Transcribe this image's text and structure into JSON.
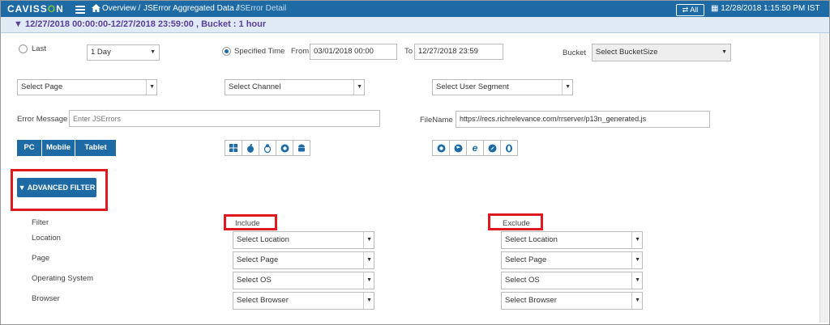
{
  "header": {
    "logo_prefix": "CAVISS",
    "logo_o": "O",
    "logo_suffix": "N",
    "breadcrumb": [
      "Overview /",
      "JSError Aggregated Data /",
      "JSError Detail"
    ],
    "all_label": "All",
    "datetime": "12/28/2018 1:15:50 PM IST"
  },
  "filter_bar": {
    "text": "12/27/2018 00:00:00-12/27/2018 23:59:00 , Bucket : 1 hour"
  },
  "time": {
    "last_label": "Last",
    "last_value": "1 Day",
    "specified_label": "Specified Time",
    "from_label": "From",
    "from_value": "03/01/2018 00:00",
    "to_label": "To",
    "to_value": "12/27/2018 23:59",
    "bucket_label": "Bucket",
    "bucket_value": "Select BucketSize"
  },
  "selects": {
    "page": "Select Page",
    "channel": "Select Channel",
    "user_segment": "Select User Segment"
  },
  "error": {
    "label": "Error Message",
    "placeholder": "Enter JSErrors",
    "filename_label": "FileName",
    "filename_value": "https://recs.richrelevance.com/rrserver/p13n_generated.js"
  },
  "devices": [
    "PC",
    "Mobile",
    "Tablet"
  ],
  "os_icons": [
    "windows-icon",
    "apple-icon",
    "linux-icon",
    "chrome-os-icon",
    "android-icon"
  ],
  "browser_icons": [
    "chrome-icon",
    "firefox-icon",
    "ie-icon",
    "safari-icon",
    "opera-icon"
  ],
  "advanced_filter": {
    "button_label": "ADVANCED FILTER",
    "filter_label": "Filter",
    "include_label": "Include",
    "exclude_label": "Exclude",
    "rows": [
      {
        "label": "Location",
        "placeholder": "Select Location"
      },
      {
        "label": "Page",
        "placeholder": "Select Page"
      },
      {
        "label": "Operating System",
        "placeholder": "Select OS"
      },
      {
        "label": "Browser",
        "placeholder": "Select Browser"
      }
    ]
  },
  "colors": {
    "primary": "#1d6aa5",
    "highlight": "#e0191f",
    "filter_text": "#5a3e9a"
  }
}
